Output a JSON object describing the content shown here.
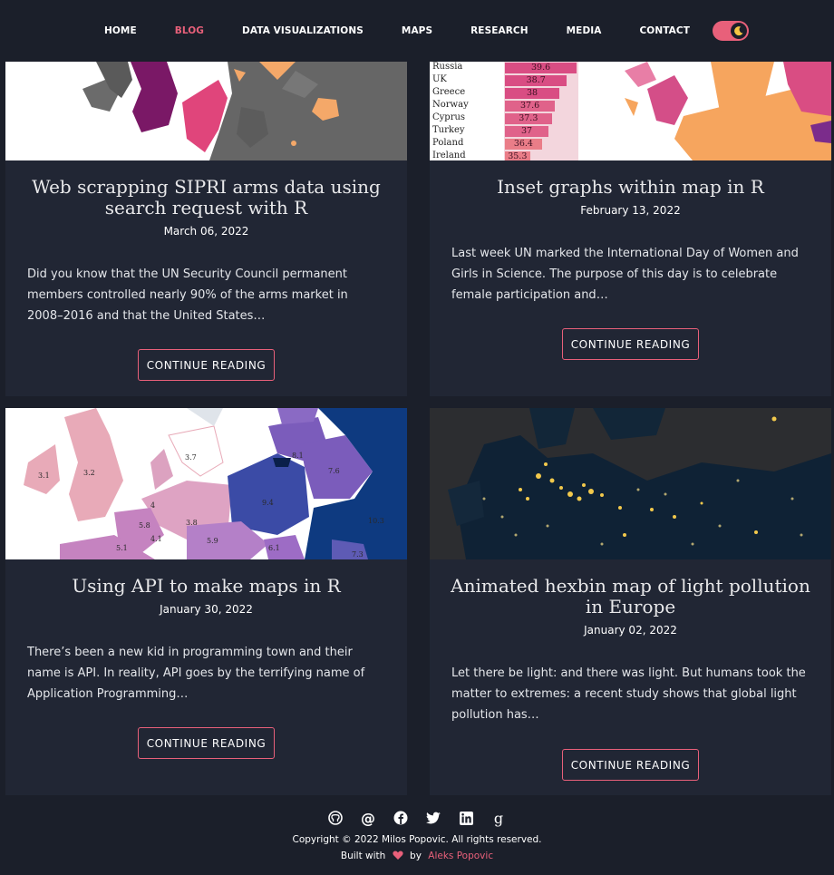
{
  "nav": {
    "items": [
      "HOME",
      "BLOG",
      "DATA VISUALIZATIONS",
      "MAPS",
      "RESEARCH",
      "MEDIA",
      "CONTACT"
    ],
    "active": "BLOG",
    "theme_toggle": "moon-icon"
  },
  "posts": [
    {
      "title": "Web scrapping SIPRI arms data using search request with R",
      "date": "March 06, 2022",
      "excerpt": "Did you know that the UN Security Council permanent members controlled nearly 90% of the arms market in 2008–2016 and that the United States…",
      "button": "CONTINUE READING"
    },
    {
      "title": "Inset graphs within map in R",
      "date": "February 13, 2022",
      "excerpt": "Last week UN marked the International Day of Women and Girls in Science. The purpose of this day is to celebrate female participation and…",
      "button": "CONTINUE READING",
      "thumb_bars": [
        {
          "country": "Russia",
          "value": "39.6"
        },
        {
          "country": "UK",
          "value": "38.7"
        },
        {
          "country": "Greece",
          "value": "38"
        },
        {
          "country": "Norway",
          "value": "37.6"
        },
        {
          "country": "Cyprus",
          "value": "37.3"
        },
        {
          "country": "Turkey",
          "value": "37"
        },
        {
          "country": "Poland",
          "value": "36.4"
        },
        {
          "country": "Ireland",
          "value": "35.3"
        }
      ]
    },
    {
      "title": "Using API to make maps in R",
      "date": "January 30, 2022",
      "excerpt": "There’s been a new kid in programming town and their name is API. In reality, API goes by the terrifying name of Application Programming…",
      "button": "CONTINUE READING",
      "thumb_labels": [
        "3.1",
        "3.2",
        "3.7",
        "8.1",
        "7.6",
        "4",
        "9.4",
        "5.8",
        "3.8",
        "4.1",
        "5.1",
        "5.9",
        "6.1",
        "7.3",
        "10.3"
      ]
    },
    {
      "title": "Animated hexbin map of light pollution in Europe",
      "date": "January 02, 2022",
      "excerpt": "Let there be light: and there was light. But humans took the matter to extremes: a recent study shows that global light pollution has…",
      "button": "CONTINUE READING"
    }
  ],
  "footer": {
    "icons": [
      "github-icon",
      "at-icon",
      "facebook-icon",
      "twitter-icon",
      "linkedin-icon",
      "google-scholar-icon"
    ],
    "copyright": "Copyright © 2022 Milos Popovic. All rights reserved.",
    "built_with": "Built with",
    "by": "by",
    "author": "Aleks Popovic",
    "accent": "#e8607a"
  }
}
